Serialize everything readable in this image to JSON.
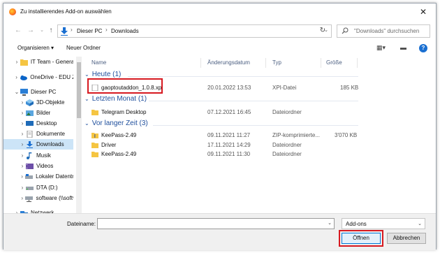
{
  "title": "Zu installierendes Add-on auswählen",
  "breadcrumb": [
    "Dieser PC",
    "Downloads"
  ],
  "search": {
    "placeholder": "\"Downloads\" durchsuchen"
  },
  "toolbar": {
    "organize": "Organisieren ▾",
    "new_folder": "Neuer Ordner"
  },
  "sidebar": {
    "items": [
      {
        "label": "IT Team - Genera",
        "icon": "folder-icon",
        "selected": false
      },
      {
        "label": "OneDrive - EDU Zi",
        "icon": "cloud-icon",
        "selected": false
      },
      {
        "label": "Dieser PC",
        "icon": "computer-icon",
        "selected": false
      },
      {
        "label": "3D-Objekte",
        "icon": "cube-icon",
        "selected": false
      },
      {
        "label": "Bilder",
        "icon": "pictures-icon",
        "selected": false
      },
      {
        "label": "Desktop",
        "icon": "desktop-icon",
        "selected": false
      },
      {
        "label": "Dokumente",
        "icon": "documents-icon",
        "selected": false
      },
      {
        "label": "Downloads",
        "icon": "download-icon",
        "selected": true
      },
      {
        "label": "Musik",
        "icon": "music-icon",
        "selected": false
      },
      {
        "label": "Videos",
        "icon": "video-icon",
        "selected": false
      },
      {
        "label": "Lokaler Datenträ",
        "icon": "drive-icon",
        "selected": false
      },
      {
        "label": "DTA (D:)",
        "icon": "drive-icon",
        "selected": false
      },
      {
        "label": "software (\\\\softv",
        "icon": "network-drive-icon",
        "selected": false
      },
      {
        "label": "Netzwerk",
        "icon": "network-icon",
        "selected": false
      }
    ]
  },
  "columns": {
    "name": "Name",
    "date": "Änderungsdatum",
    "type": "Typ",
    "size": "Größe"
  },
  "groups": [
    {
      "label": "Heute (1)",
      "files": [
        {
          "name": "gaoptoutaddon_1.0.8.xpi",
          "date": "20.01.2022 13:53",
          "type": "XPI-Datei",
          "size": "185 KB",
          "icon": "file-icon"
        }
      ]
    },
    {
      "label": "Letzten Monat (1)",
      "files": [
        {
          "name": "Telegram Desktop",
          "date": "07.12.2021 16:45",
          "type": "Dateiordner",
          "size": "",
          "icon": "folder-icon"
        }
      ]
    },
    {
      "label": "Vor langer Zeit (3)",
      "files": [
        {
          "name": "KeePass-2.49",
          "date": "09.11.2021 11:27",
          "type": "ZIP-komprimierte...",
          "size": "3'070 KB",
          "icon": "zip-folder-icon"
        },
        {
          "name": "Driver",
          "date": "17.11.2021 14:29",
          "type": "Dateiordner",
          "size": "",
          "icon": "folder-icon"
        },
        {
          "name": "KeePass-2.49",
          "date": "09.11.2021 11:30",
          "type": "Dateiordner",
          "size": "",
          "icon": "folder-icon"
        }
      ]
    }
  ],
  "footer": {
    "filename_label": "Dateiname:",
    "filename_value": "",
    "filetype": "Add-ons",
    "open": "Öffnen",
    "cancel": "Abbrechen"
  },
  "colors": {
    "accent": "#0078d7",
    "group_text": "#1e4e9c",
    "highlight": "#d71920",
    "selected_bg": "#cce4f7"
  }
}
